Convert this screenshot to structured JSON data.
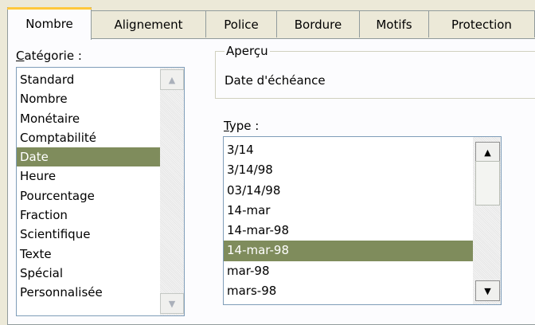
{
  "tabs": [
    {
      "label": "Nombre",
      "active": true
    },
    {
      "label": "Alignement",
      "active": false
    },
    {
      "label": "Police",
      "active": false
    },
    {
      "label": "Bordure",
      "active": false
    },
    {
      "label": "Motifs",
      "active": false
    },
    {
      "label": "Protection",
      "active": false
    }
  ],
  "category": {
    "label_first": "C",
    "label_rest": "atégorie :",
    "items": [
      "Standard",
      "Nombre",
      "Monétaire",
      "Comptabilité",
      "Date",
      "Heure",
      "Pourcentage",
      "Fraction",
      "Scientifique",
      "Texte",
      "Spécial",
      "Personnalisée"
    ],
    "selected": "Date"
  },
  "preview": {
    "legend": "Aperçu",
    "value": "Date d'échéance"
  },
  "type": {
    "label_first": "T",
    "label_rest": "ype :",
    "items": [
      "3/14",
      "3/14/98",
      "03/14/98",
      "14-mar",
      "14-mar-98",
      "14-mar-98",
      "mar-98",
      "mars-98"
    ],
    "selected_index": 5
  },
  "icons": {
    "scroll_up": "triangle-up-icon",
    "scroll_down": "triangle-down-icon"
  },
  "colors": {
    "selection": "#7f8c5c",
    "active_tab_accent": "#ffc83c",
    "dialog_background": "#ece9d8"
  }
}
